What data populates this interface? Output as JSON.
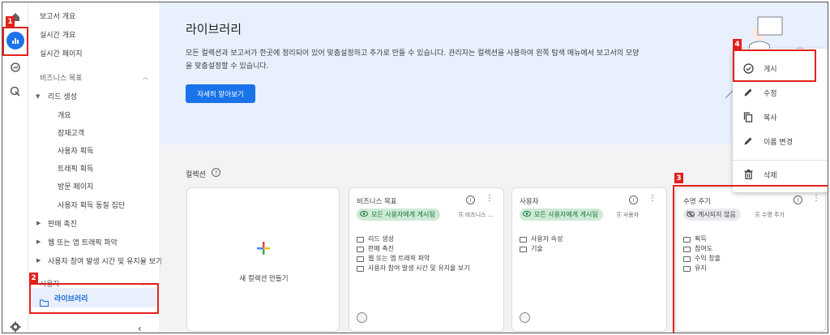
{
  "sidebar": {
    "top_items": [
      "보고서 개요",
      "실시간 개요",
      "실시간 페이지"
    ],
    "section_business": "비즈니스 목표",
    "lead_group": "리드 생성",
    "lead_items": [
      "개요",
      "잠재고객",
      "사용자 획득",
      "트래픽 획득",
      "방문 페이지",
      "사용자 획득 동질 집단"
    ],
    "collapsed_items": [
      "판매 촉진",
      "웹 또는 앱 트래픽 파악",
      "사용자 참여 발생 시간 및 유지율 보기"
    ],
    "section_user": "사용자",
    "library": "라이브러리"
  },
  "hero": {
    "title": "라이브러리",
    "desc": "모든 컬렉션과 보고서가 한곳에 정리되어 있어 맞춤설정하고 추가로 만들 수 있습니다. 관리자는 컬렉션을 사용하여 왼쪽 탐색 메뉴에서 보고서의 모양을 맞춤설정할 수 있습니다.",
    "learn_more": "자세히 알아보기"
  },
  "collections": {
    "title": "컬렉션",
    "new_label": "새 컬렉션 만들기",
    "cards": [
      {
        "title": "비즈니스 목표",
        "badge": "모든 사용자에게 게시됨",
        "source": "비즈니스 ...",
        "items": [
          "리드 생성",
          "판매 촉진",
          "웹 또는 앱 트래픽 파악",
          "사용자 참여 발생 시간 및 유지율 보기"
        ]
      },
      {
        "title": "사용자",
        "badge": "모든 사용자에게 게시됨",
        "source": "사용자",
        "items": [
          "사용자 속성",
          "기술"
        ]
      },
      {
        "title": "수명 주기",
        "badge": "게시되지 않음",
        "source": "수명 주기",
        "items": [
          "획득",
          "참여도",
          "수익 창출",
          "유지"
        ]
      }
    ]
  },
  "menu": {
    "items": [
      "게시",
      "수정",
      "복사",
      "이름 변경",
      "삭제"
    ]
  },
  "annotations": [
    "1",
    "2",
    "3",
    "4"
  ],
  "colors": {
    "accent": "#1a73e8",
    "annotation": "#e2211c",
    "published_bg": "#ceead6",
    "published_fg": "#137333"
  }
}
